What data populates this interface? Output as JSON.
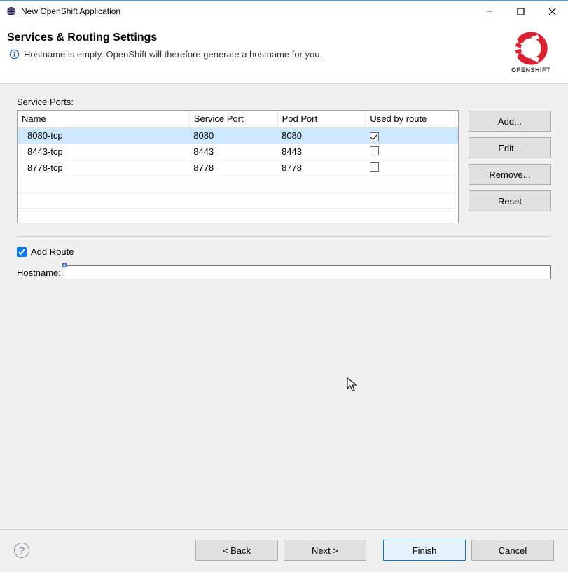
{
  "window": {
    "title": "New OpenShift Application"
  },
  "header": {
    "title": "Services & Routing Settings",
    "info": "Hostname is empty. OpenShift will therefore generate a hostname for you.",
    "logo_label": "OPENSHIFT"
  },
  "ports": {
    "section_label": "Service Ports:",
    "columns": {
      "name": "Name",
      "service_port": "Service Port",
      "pod_port": "Pod Port",
      "used_by_route": "Used by route"
    },
    "rows": [
      {
        "name": "8080-tcp",
        "service_port": "8080",
        "pod_port": "8080",
        "used_by_route": true,
        "selected": true
      },
      {
        "name": "8443-tcp",
        "service_port": "8443",
        "pod_port": "8443",
        "used_by_route": false,
        "selected": false
      },
      {
        "name": "8778-tcp",
        "service_port": "8778",
        "pod_port": "8778",
        "used_by_route": false,
        "selected": false
      }
    ]
  },
  "side_buttons": {
    "add": "Add...",
    "edit": "Edit...",
    "remove": "Remove...",
    "reset": "Reset"
  },
  "route": {
    "add_route_label": "Add Route",
    "add_route_checked": true,
    "hostname_label": "Hostname:",
    "hostname_value": ""
  },
  "footer": {
    "help_tooltip": "Help",
    "back": "< Back",
    "next": "Next >",
    "finish": "Finish",
    "cancel": "Cancel"
  }
}
